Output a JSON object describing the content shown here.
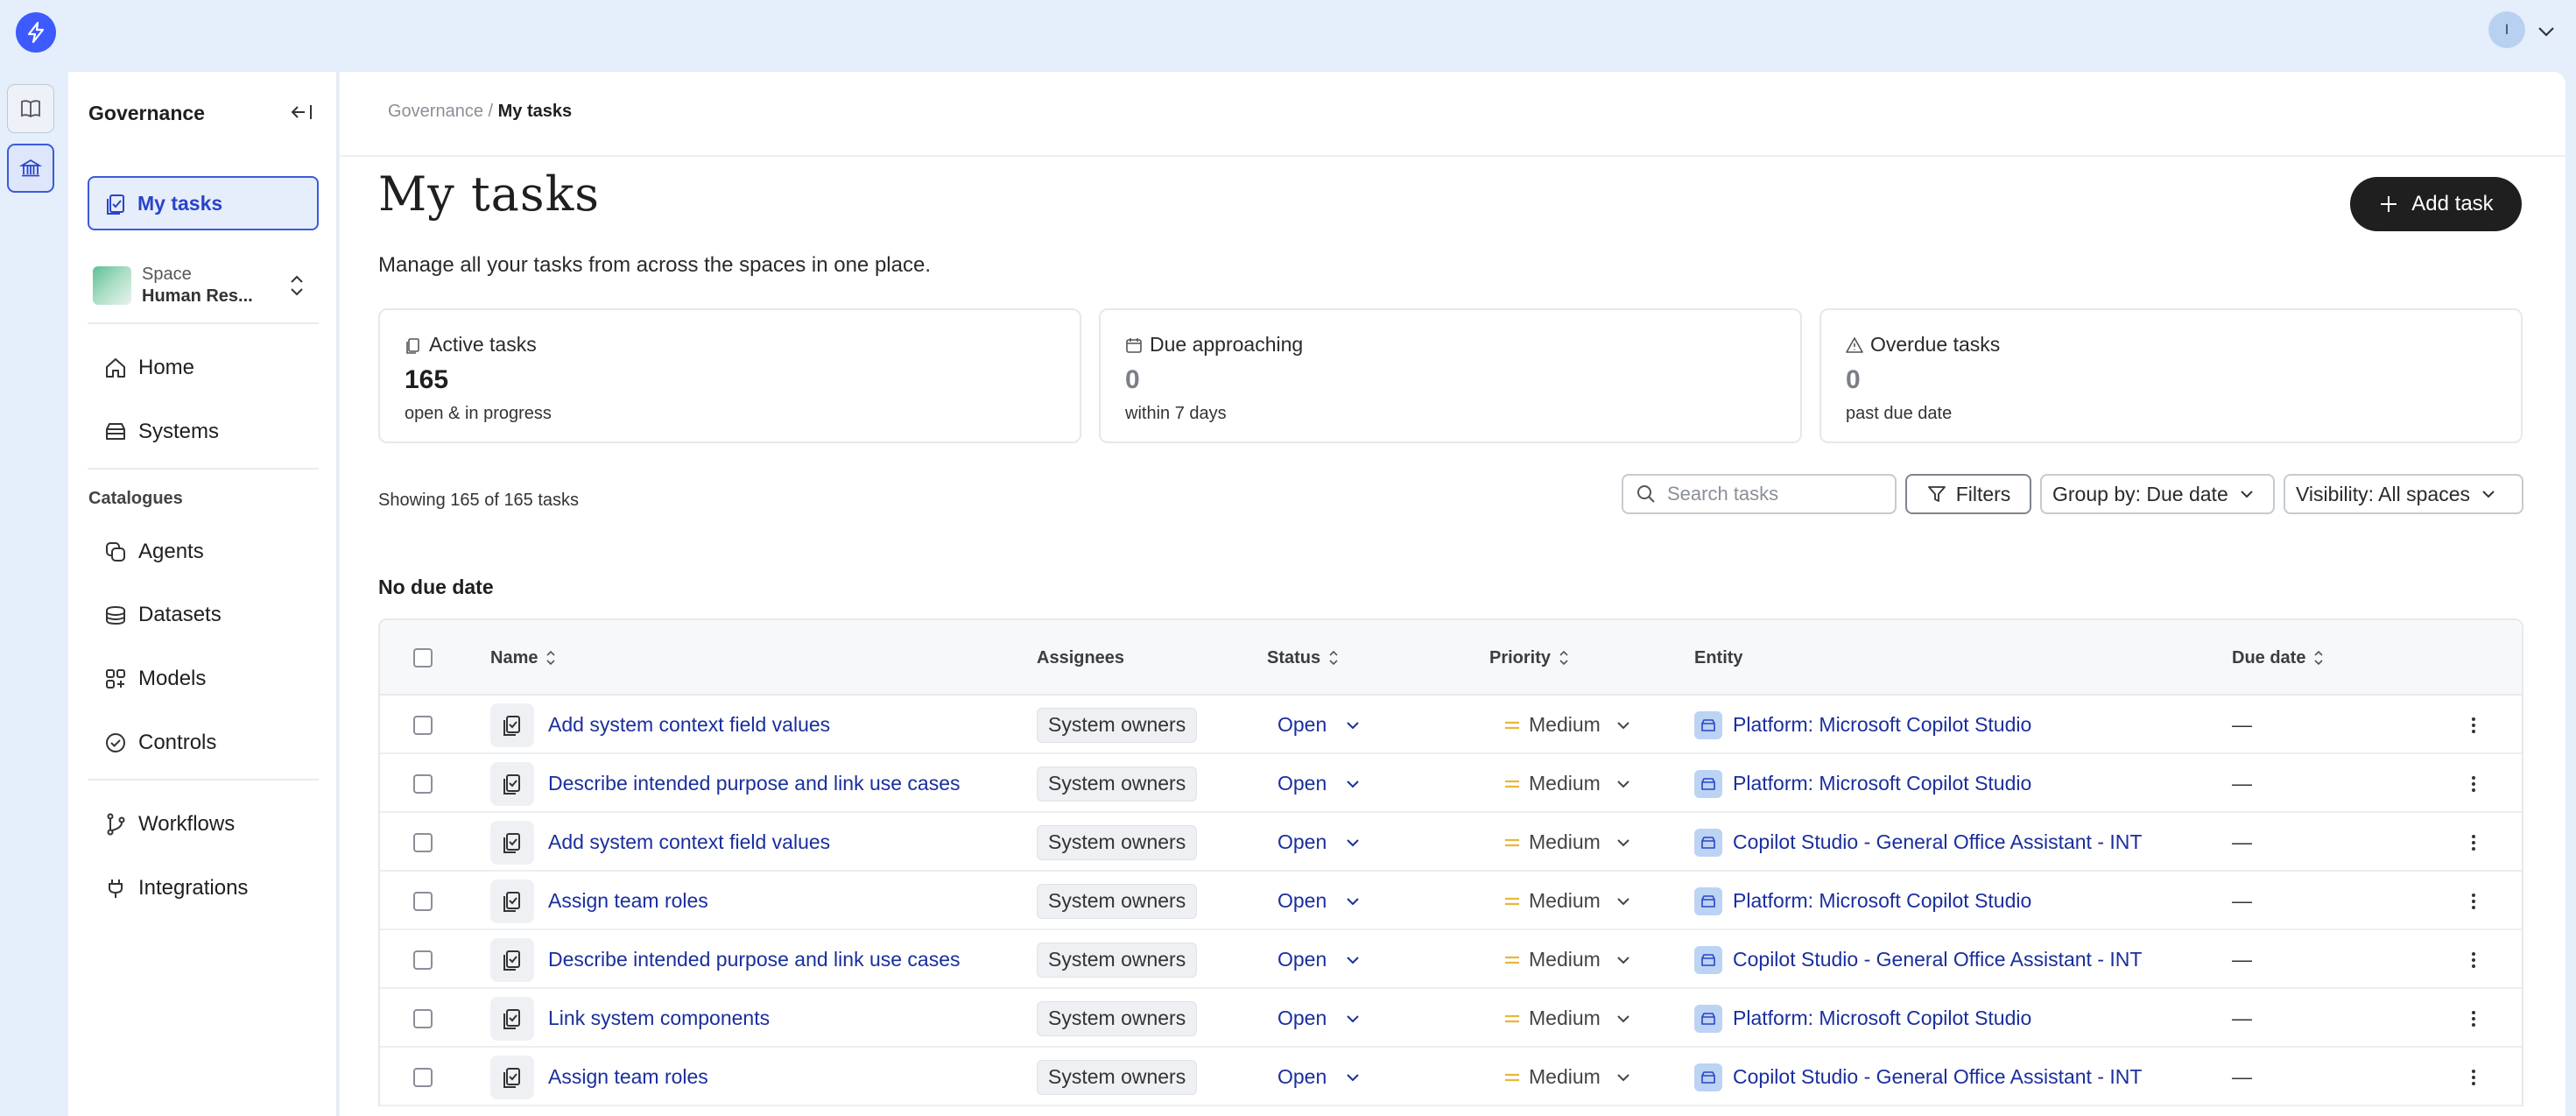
{
  "user": {
    "avatar_initial": "I"
  },
  "sidebar": {
    "title": "Governance",
    "active_item": "My tasks",
    "space": {
      "label": "Space",
      "name": "Human Res..."
    },
    "nav_primary": [
      {
        "label": "Home",
        "icon": "home-icon"
      },
      {
        "label": "Systems",
        "icon": "systems-icon"
      }
    ],
    "catalogues_label": "Catalogues",
    "catalogues": [
      {
        "label": "Agents",
        "icon": "agents-icon"
      },
      {
        "label": "Datasets",
        "icon": "datasets-icon"
      },
      {
        "label": "Models",
        "icon": "models-icon"
      },
      {
        "label": "Controls",
        "icon": "controls-icon"
      }
    ],
    "nav_secondary": [
      {
        "label": "Workflows",
        "icon": "workflows-icon"
      },
      {
        "label": "Integrations",
        "icon": "integrations-icon"
      }
    ]
  },
  "breadcrumb": {
    "parent": "Governance",
    "separator": " / ",
    "current": "My tasks"
  },
  "page": {
    "title": "My tasks",
    "subtitle": "Manage all your tasks from across the spaces in one place.",
    "add_task_label": "Add task"
  },
  "stats": [
    {
      "title": "Active tasks",
      "value": "165",
      "sub": "open & in progress",
      "icon": "active-tasks-icon"
    },
    {
      "title": "Due approaching",
      "value": "0",
      "sub": "within 7 days",
      "icon": "calendar-icon"
    },
    {
      "title": "Overdue tasks",
      "value": "0",
      "sub": "past due date",
      "icon": "warning-icon"
    }
  ],
  "toolbar": {
    "showing": "Showing 165 of 165 tasks",
    "search_placeholder": "Search tasks",
    "filters_label": "Filters",
    "group_by_label": "Group by: Due date",
    "visibility_label": "Visibility: All spaces"
  },
  "group_heading": "No due date",
  "table": {
    "columns": {
      "name": "Name",
      "assignees": "Assignees",
      "status": "Status",
      "priority": "Priority",
      "entity": "Entity",
      "due_date": "Due date"
    },
    "rows": [
      {
        "name": "Add system context field values",
        "assignee": "System owners",
        "status": "Open",
        "priority": "Medium",
        "entity": "Platform: Microsoft Copilot Studio",
        "due": "—"
      },
      {
        "name": "Describe intended purpose and link use cases",
        "assignee": "System owners",
        "status": "Open",
        "priority": "Medium",
        "entity": "Platform: Microsoft Copilot Studio",
        "due": "—"
      },
      {
        "name": "Add system context field values",
        "assignee": "System owners",
        "status": "Open",
        "priority": "Medium",
        "entity": "Copilot Studio - General Office Assistant - INT",
        "due": "—"
      },
      {
        "name": "Assign team roles",
        "assignee": "System owners",
        "status": "Open",
        "priority": "Medium",
        "entity": "Platform: Microsoft Copilot Studio",
        "due": "—"
      },
      {
        "name": "Describe intended purpose and link use cases",
        "assignee": "System owners",
        "status": "Open",
        "priority": "Medium",
        "entity": "Copilot Studio - General Office Assistant - INT",
        "due": "—"
      },
      {
        "name": "Link system components",
        "assignee": "System owners",
        "status": "Open",
        "priority": "Medium",
        "entity": "Platform: Microsoft Copilot Studio",
        "due": "—"
      },
      {
        "name": "Assign team roles",
        "assignee": "System owners",
        "status": "Open",
        "priority": "Medium",
        "entity": "Copilot Studio - General Office Assistant - INT",
        "due": "—"
      }
    ]
  },
  "colors": {
    "accent": "#3b5bdb",
    "link": "#1a2e9e",
    "priority_medium": "#e8b73a",
    "background": "#e5eefb"
  }
}
